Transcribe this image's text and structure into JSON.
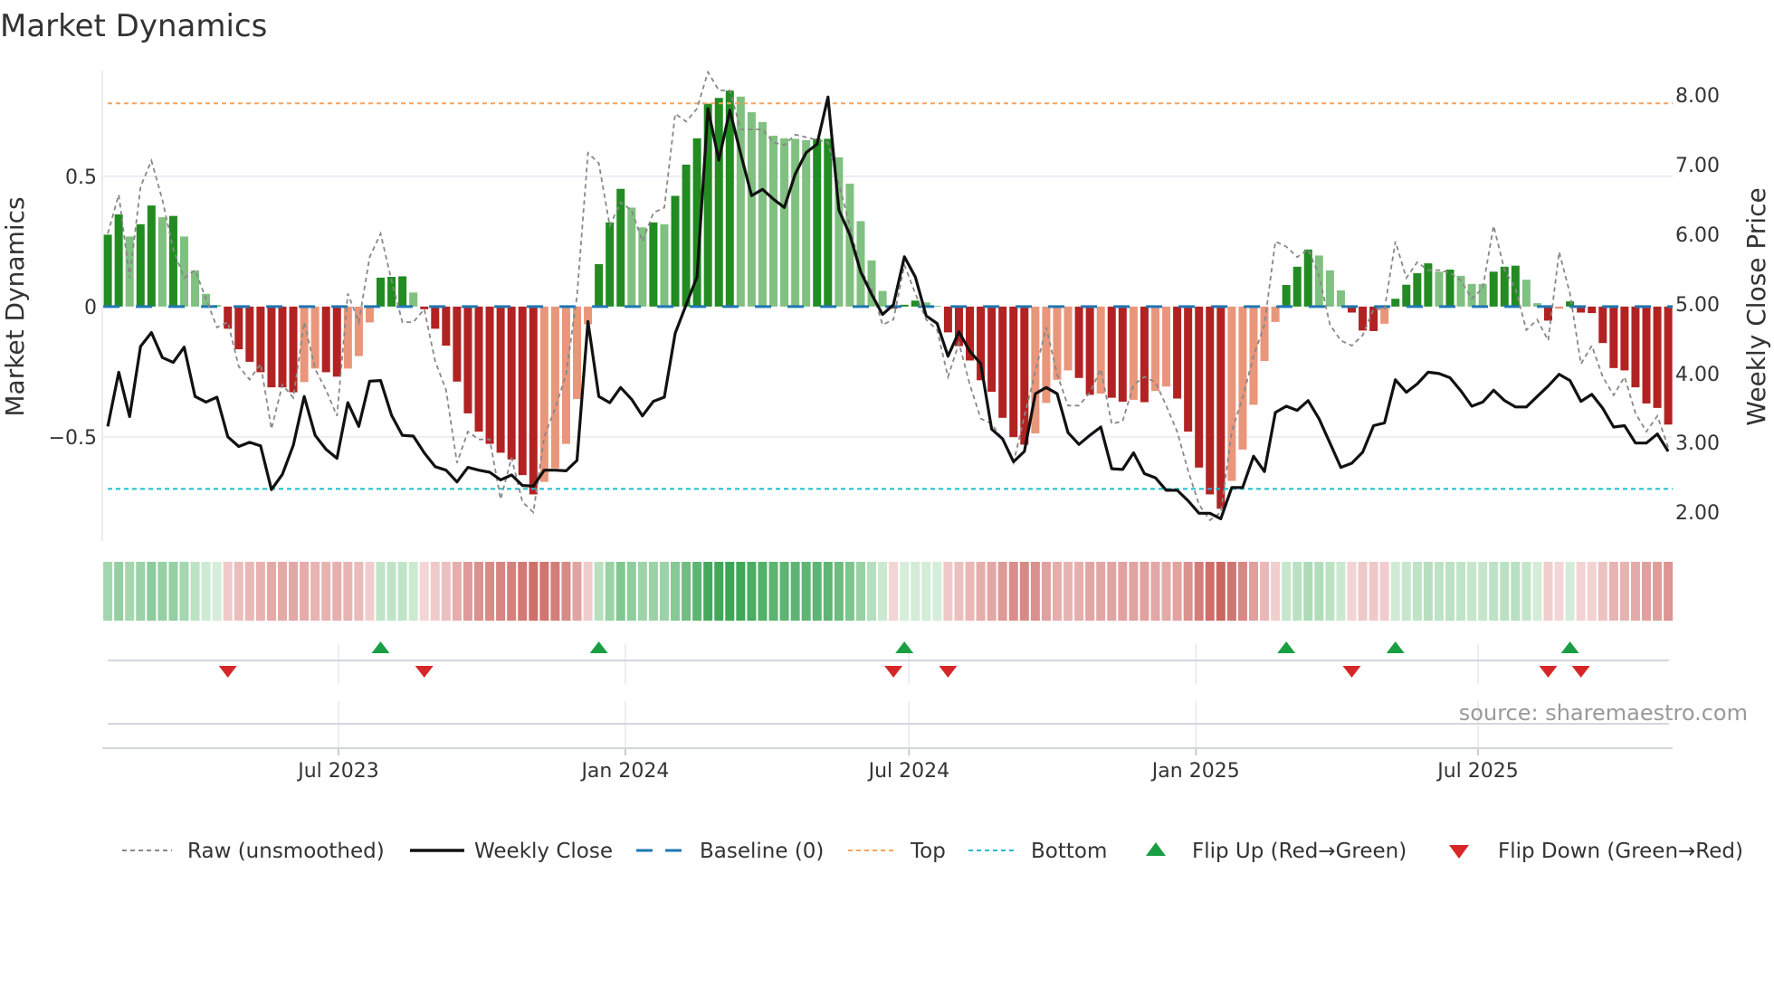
{
  "chart_data": {
    "type": "bar",
    "title": "Market Dynamics",
    "ylabel_left": "Market Dynamics",
    "ylabel_right": "Weekly Close Price",
    "x_start": "2023-02-03",
    "x_step_days": 7,
    "x_ticks": [
      {
        "date": "2023-07-01",
        "label": "Jul 2023"
      },
      {
        "date": "2024-01-01",
        "label": "Jan 2024"
      },
      {
        "date": "2024-07-01",
        "label": "Jul 2024"
      },
      {
        "date": "2025-01-01",
        "label": "Jan 2025"
      },
      {
        "date": "2025-07-01",
        "label": "Jul 2025"
      }
    ],
    "y_left": {
      "range": [
        -0.9,
        0.906
      ],
      "ticks": [
        {
          "value": 0.5,
          "label": "0.5"
        },
        {
          "value": 0,
          "label": "0"
        },
        {
          "value": -0.5,
          "label": "−0.5"
        }
      ],
      "grid": true
    },
    "y_right": {
      "range": [
        1.58,
        8.35
      ],
      "ticks": [
        {
          "value": 8,
          "label": "8.00"
        },
        {
          "value": 7,
          "label": "7.00"
        },
        {
          "value": 6,
          "label": "6.00"
        },
        {
          "value": 5,
          "label": "5.00"
        },
        {
          "value": 4,
          "label": "4.00"
        },
        {
          "value": 3,
          "label": "3.00"
        },
        {
          "value": 2,
          "label": "2.00"
        }
      ]
    },
    "levels": {
      "top": 0.78,
      "bottom": -0.7,
      "baseline": 0
    },
    "momentum": [
      0.276,
      0.354,
      0.269,
      0.316,
      0.388,
      0.343,
      0.348,
      0.269,
      0.139,
      0.049,
      0.006,
      -0.085,
      -0.164,
      -0.212,
      -0.252,
      -0.31,
      -0.31,
      -0.329,
      -0.29,
      -0.238,
      -0.252,
      -0.269,
      -0.238,
      -0.19,
      -0.061,
      0.111,
      0.114,
      0.116,
      0.054,
      -0.01,
      -0.085,
      -0.15,
      -0.288,
      -0.41,
      -0.48,
      -0.527,
      -0.561,
      -0.587,
      -0.647,
      -0.721,
      -0.673,
      -0.621,
      -0.527,
      -0.355,
      -0.068,
      0.163,
      0.323,
      0.452,
      0.38,
      0.304,
      0.323,
      0.316,
      0.425,
      0.545,
      0.646,
      0.779,
      0.801,
      0.829,
      0.806,
      0.746,
      0.708,
      0.656,
      0.646,
      0.644,
      0.639,
      0.644,
      0.644,
      0.573,
      0.472,
      0.328,
      0.177,
      0.06,
      -0.008,
      0.007,
      0.023,
      0.016,
      0.003,
      -0.099,
      -0.152,
      -0.207,
      -0.283,
      -0.327,
      -0.427,
      -0.501,
      -0.53,
      -0.487,
      -0.37,
      -0.281,
      -0.245,
      -0.274,
      -0.339,
      -0.334,
      -0.35,
      -0.365,
      -0.358,
      -0.367,
      -0.324,
      -0.307,
      -0.353,
      -0.48,
      -0.618,
      -0.721,
      -0.776,
      -0.669,
      -0.549,
      -0.377,
      -0.209,
      -0.059,
      0.083,
      0.153,
      0.219,
      0.196,
      0.139,
      0.062,
      -0.023,
      -0.092,
      -0.094,
      -0.066,
      0.03,
      0.084,
      0.128,
      0.166,
      0.134,
      0.142,
      0.118,
      0.087,
      0.087,
      0.134,
      0.153,
      0.157,
      0.103,
      0.013,
      -0.054,
      -0.008,
      0.02,
      -0.023,
      -0.025,
      -0.14,
      -0.236,
      -0.245,
      -0.31,
      -0.372,
      -0.389,
      -0.453
    ],
    "shade": "GGgGGgGggggRRRRRRRrrRRrrrGGGgRRRRRRRRRRRrrrrrGGGggGgGGGGGGgggggggGGgggggRGGggRRRRRRRRrrrrRRrRRrRrrRRRRRrrrrrGGGgggRRRrGGGGgGgggGGGggRrGRRRRRRRRR",
    "raw": [
      0.28,
      0.43,
      0.11,
      0.46,
      0.56,
      0.41,
      0.22,
      0.11,
      0.14,
      0.03,
      -0.08,
      -0.06,
      -0.23,
      -0.28,
      -0.22,
      -0.47,
      -0.3,
      -0.35,
      -0.06,
      -0.24,
      -0.32,
      -0.42,
      0.05,
      -0.06,
      0.19,
      0.28,
      0.1,
      -0.06,
      -0.06,
      -0.01,
      -0.21,
      -0.32,
      -0.6,
      -0.48,
      -0.51,
      -0.51,
      -0.74,
      -0.58,
      -0.75,
      -0.79,
      -0.5,
      -0.39,
      -0.26,
      0.04,
      0.59,
      0.55,
      0.31,
      0.4,
      0.37,
      0.25,
      0.36,
      0.38,
      0.74,
      0.71,
      0.76,
      0.9,
      0.83,
      0.83,
      0.68,
      0.68,
      0.68,
      0.63,
      0.62,
      0.66,
      0.65,
      0.64,
      0.63,
      0.47,
      0.31,
      0.14,
      0.07,
      -0.07,
      -0.05,
      0.16,
      0.05,
      -0.05,
      -0.09,
      -0.27,
      -0.14,
      -0.3,
      -0.43,
      -0.45,
      -0.51,
      -0.6,
      -0.42,
      -0.25,
      -0.08,
      -0.26,
      -0.38,
      -0.38,
      -0.33,
      -0.24,
      -0.45,
      -0.44,
      -0.3,
      -0.27,
      -0.29,
      -0.38,
      -0.48,
      -0.63,
      -0.76,
      -0.82,
      -0.79,
      -0.48,
      -0.35,
      -0.19,
      -0.07,
      0.25,
      0.23,
      0.19,
      0.22,
      0.12,
      -0.07,
      -0.13,
      -0.15,
      -0.11,
      -0.01,
      -0.01,
      0.25,
      0.11,
      0.17,
      0.14,
      0.14,
      0.13,
      0.1,
      0.03,
      0.07,
      0.31,
      0.14,
      0.07,
      -0.09,
      -0.05,
      -0.13,
      0.21,
      0.05,
      -0.22,
      -0.15,
      -0.27,
      -0.34,
      -0.27,
      -0.41,
      -0.48,
      -0.42,
      -0.54
    ],
    "close": [
      3.23,
      4.01,
      3.37,
      4.38,
      4.58,
      4.22,
      4.15,
      4.37,
      3.66,
      3.58,
      3.65,
      3.08,
      2.94,
      3.0,
      2.95,
      2.32,
      2.54,
      2.96,
      3.66,
      3.1,
      2.9,
      2.77,
      3.57,
      3.23,
      3.88,
      3.89,
      3.39,
      3.1,
      3.09,
      2.85,
      2.65,
      2.6,
      2.43,
      2.64,
      2.6,
      2.57,
      2.46,
      2.53,
      2.38,
      2.37,
      2.6,
      2.6,
      2.59,
      2.74,
      4.74,
      3.66,
      3.57,
      3.79,
      3.62,
      3.38,
      3.59,
      3.65,
      4.57,
      4.98,
      5.38,
      7.8,
      7.06,
      7.78,
      7.15,
      6.55,
      6.64,
      6.5,
      6.38,
      6.86,
      7.17,
      7.29,
      7.97,
      6.34,
      5.99,
      5.45,
      5.13,
      4.84,
      4.98,
      5.67,
      5.38,
      4.82,
      4.71,
      4.24,
      4.59,
      4.31,
      4.13,
      3.19,
      3.05,
      2.72,
      2.87,
      3.7,
      3.79,
      3.7,
      3.14,
      2.97,
      3.1,
      3.22,
      2.62,
      2.61,
      2.85,
      2.55,
      2.49,
      2.31,
      2.31,
      2.16,
      1.98,
      1.98,
      1.9,
      2.35,
      2.35,
      2.8,
      2.58,
      3.43,
      3.52,
      3.46,
      3.6,
      3.34,
      2.99,
      2.64,
      2.7,
      2.86,
      3.24,
      3.28,
      3.9,
      3.72,
      3.84,
      4.01,
      3.99,
      3.93,
      3.74,
      3.52,
      3.58,
      3.75,
      3.6,
      3.51,
      3.51,
      3.66,
      3.81,
      3.98,
      3.89,
      3.59,
      3.69,
      3.49,
      3.22,
      3.24,
      2.99,
      2.99,
      3.12,
      2.87
    ],
    "legend": {
      "placement": "bottom",
      "raw": "Raw (unsmoothed)",
      "close": "Weekly Close",
      "baseline": "Baseline (0)",
      "top": "Top",
      "bottom": "Bottom",
      "flip_up": "Flip Up (Red→Green)",
      "flip_down": "Flip Down (Green→Red)"
    },
    "colors": {
      "strong_green": "#228b22",
      "weak_green": "#80c080",
      "strong_red": "#b22222",
      "weak_red": "#e9967a",
      "raw": "#888888",
      "close": "#111111",
      "baseline": "#1f77b4",
      "top": "#f4a460",
      "bottom": "#17becf",
      "flip_up": "#1a9e44",
      "flip_down": "#d62728"
    },
    "source": "source: sharemaestro.com"
  }
}
